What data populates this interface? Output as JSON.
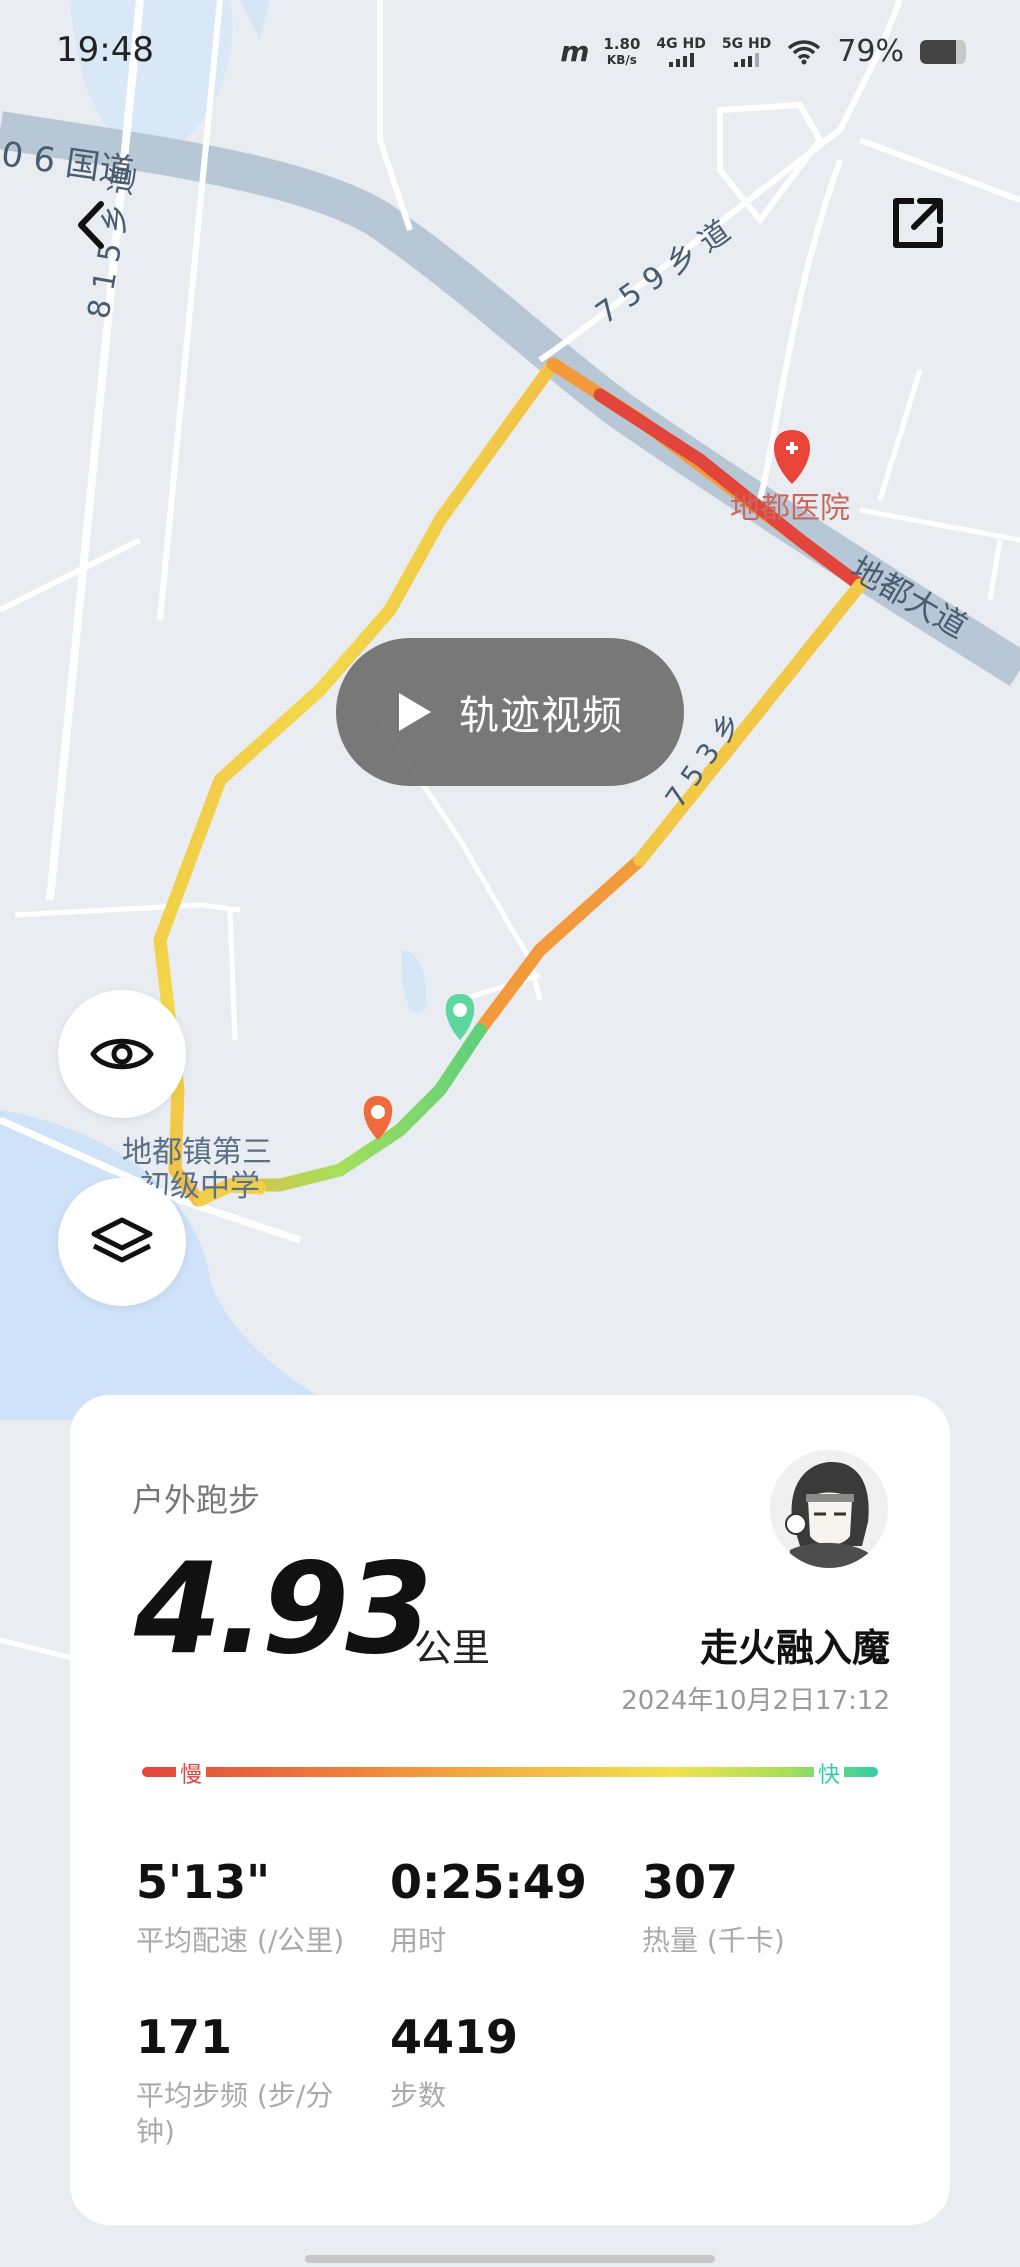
{
  "status_bar": {
    "time": "19:48",
    "carrier_logo": "m",
    "net_speed_value": "1.80",
    "net_speed_unit": "KB/s",
    "sim1_label": "4G HD",
    "sim2_label": "5G HD",
    "battery_percent_text": "79%",
    "battery_level": 0.79
  },
  "map": {
    "labels": {
      "road_guodao": "0 6 国道",
      "road_815": "8 1 5 乡 道",
      "road_759": "7 5 9 乡 道",
      "road_diduddao": "地都大道",
      "hospital": "地都医院",
      "road_7xx": "7 5 3 乡",
      "school_line1": "地都镇第三",
      "school_line2": "初级中学"
    },
    "colors": {
      "slow": "#e2453c",
      "mid": "#f4b441",
      "fast": "#5fd07a",
      "start_pin": "#5ed6a0",
      "end_pin": "#ef6b3e",
      "hospital_pin": "#e8443a"
    }
  },
  "controls": {
    "back_icon": "chevron-left-icon",
    "share_icon": "share-external-icon",
    "video_button_label": "轨迹视频",
    "eye_icon": "eye-icon",
    "layers_icon": "layers-icon"
  },
  "summary": {
    "sport_type": "户外跑步",
    "distance": "4.93",
    "distance_unit": "公里",
    "username": "走火融入魔",
    "datetime": "2024年10月2日17:12",
    "pace_slow_label": "慢",
    "pace_fast_label": "快",
    "stats": [
      {
        "value": "5'13\"",
        "label": "平均配速 (/公里)"
      },
      {
        "value": "0:25:49",
        "label": "用时"
      },
      {
        "value": "307",
        "label": "热量 (千卡)"
      },
      {
        "value": "171",
        "label": "平均步频 (步/分钟)"
      },
      {
        "value": "4419",
        "label": "步数"
      }
    ]
  }
}
